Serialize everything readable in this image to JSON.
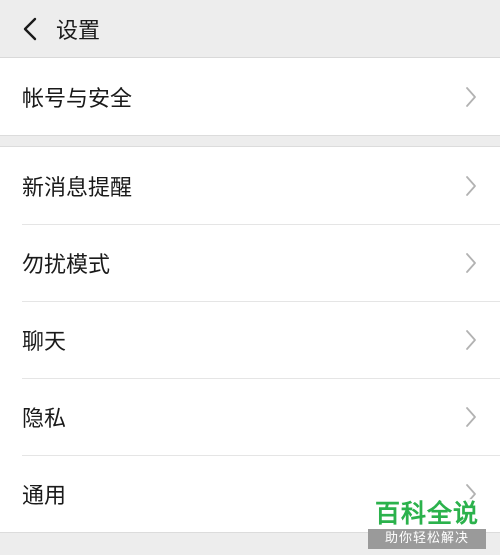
{
  "header": {
    "title": "设置",
    "back_icon": "chevron-left-icon"
  },
  "sections": [
    {
      "items": [
        {
          "label": "帐号与安全"
        }
      ]
    },
    {
      "items": [
        {
          "label": "新消息提醒"
        },
        {
          "label": "勿扰模式"
        },
        {
          "label": "聊天"
        },
        {
          "label": "隐私"
        },
        {
          "label": "通用"
        }
      ]
    }
  ],
  "watermark": {
    "main": "百科全说",
    "sub": "助你轻松解决"
  },
  "colors": {
    "background": "#ededed",
    "card": "#ffffff",
    "chevron": "#b2b2b2",
    "watermark_green": "#2bb24c"
  }
}
